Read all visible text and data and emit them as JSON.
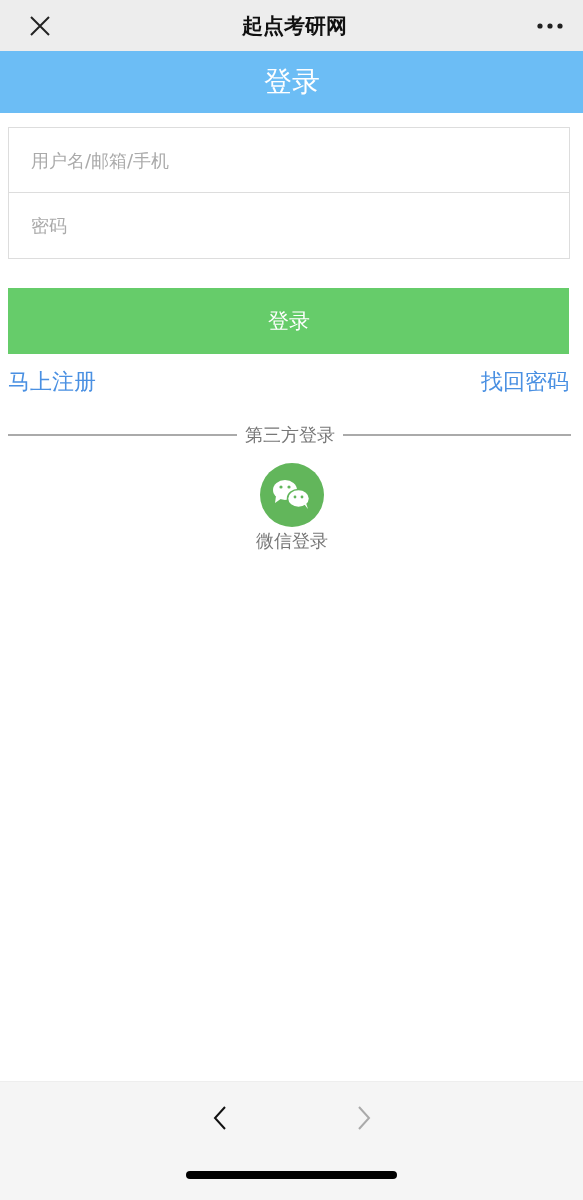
{
  "browser_bar": {
    "title": "起点考研网"
  },
  "header": {
    "title": "登录"
  },
  "form": {
    "fields": [
      {
        "placeholder": "用户名/邮箱/手机"
      },
      {
        "placeholder": "密码"
      }
    ],
    "submit": "登录"
  },
  "links": {
    "register": "马上注册",
    "recover": "找回密码"
  },
  "third_party": {
    "heading": "第三方登录",
    "label": "微信登录"
  },
  "nav": [
    {
      "kind": "back",
      "disabled": false
    },
    {
      "kind": "forward",
      "disabled": true
    }
  ]
}
